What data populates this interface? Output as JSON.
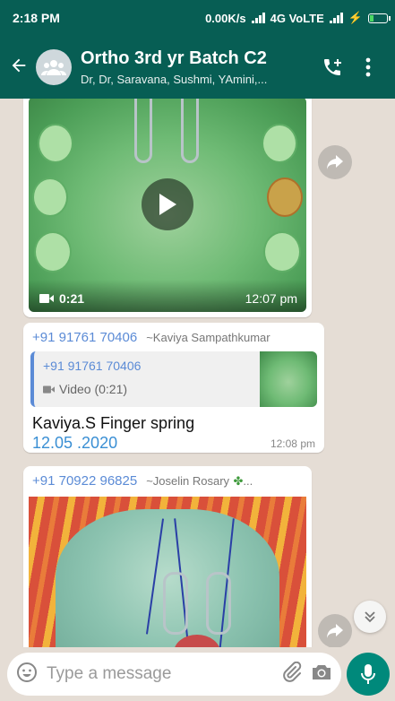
{
  "status_bar": {
    "time": "2:18 PM",
    "net_speed": "0.00K/s",
    "network": "4G VoLTE",
    "battery_charging": true
  },
  "header": {
    "title": "Ortho 3rd yr Batch C2",
    "subtitle": "Dr, Dr, Saravana, Sushmi, YAmini,..."
  },
  "messages": [
    {
      "type": "video",
      "duration": "0:21",
      "time": "12:07 pm"
    },
    {
      "type": "reply",
      "sender_number": "+91 91761 70406",
      "sender_name": "~Kaviya Sampathkumar",
      "quoted_number": "+91 91761 70406",
      "quoted_type": "Video (0:21)",
      "text": "Kaviya.S Finger spring",
      "date_link": "12.05 .2020",
      "time": "12:08 pm"
    },
    {
      "type": "image",
      "sender_number": "+91 70922 96825",
      "sender_name": "~Joselin Rosary"
    }
  ],
  "input": {
    "placeholder": "Type a message"
  },
  "colors": {
    "header": "#075e54",
    "chat_bg": "#e5ddd5",
    "accent": "#00897b",
    "sender_link": "#5b8bd6"
  },
  "icons": [
    "back-arrow-icon",
    "group-avatar-icon",
    "add-call-icon",
    "more-vert-icon",
    "play-icon",
    "video-icon",
    "forward-icon",
    "emoji-icon",
    "attach-icon",
    "camera-icon",
    "mic-icon",
    "chevron-double-down-icon"
  ]
}
